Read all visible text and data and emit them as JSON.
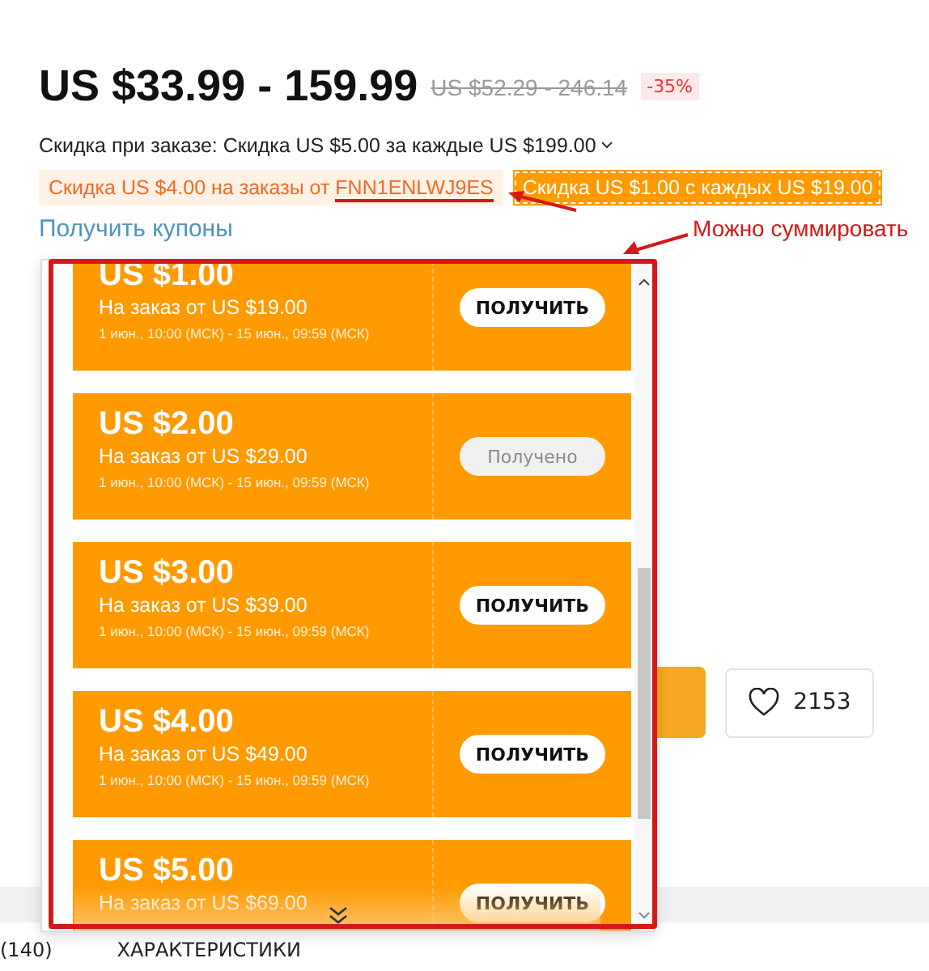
{
  "price": {
    "current": "US $33.99 - 159.99",
    "original": "US $52.29 - 246.14",
    "discount": "-35%"
  },
  "order_discount": {
    "label": "Скидка при заказе: Скидка US $5.00 за каждые US $199.00"
  },
  "promos": [
    {
      "kind": "code",
      "text": "Скидка US $4.00 на заказы от ",
      "code": "FNN1ENLWJ9ES"
    },
    {
      "kind": "store",
      "text": "Скидка US $1.00 с каждых US $19.00"
    }
  ],
  "get_coupons_link": "Получить купоны",
  "annotation": {
    "note": "Можно суммировать"
  },
  "coupons": [
    {
      "amount": "US $1.00",
      "min_order": "На заказ от US $19.00",
      "period": "1 июн., 10:00 (МСК) - 15 июн., 09:59 (МСК)",
      "button": "ПОЛУЧИТЬ",
      "received": false
    },
    {
      "amount": "US $2.00",
      "min_order": "На заказ от US $29.00",
      "period": "1 июн., 10:00 (МСК) - 15 июн., 09:59 (МСК)",
      "button": "Получено",
      "received": true
    },
    {
      "amount": "US $3.00",
      "min_order": "На заказ от US $39.00",
      "period": "1 июн., 10:00 (МСК) - 15 июн., 09:59 (МСК)",
      "button": "ПОЛУЧИТЬ",
      "received": false
    },
    {
      "amount": "US $4.00",
      "min_order": "На заказ от US $49.00",
      "period": "1 июн., 10:00 (МСК) - 15 июн., 09:59 (МСК)",
      "button": "ПОЛУЧИТЬ",
      "received": false
    },
    {
      "amount": "US $5.00",
      "min_order": "На заказ от US $69.00",
      "button": "ПОЛУЧИТЬ",
      "received": false
    }
  ],
  "wishlist": {
    "count": "2153"
  },
  "tabs": [
    {
      "label": "(140)"
    },
    {
      "label": "ХАРАКТЕРИСТИКИ"
    }
  ]
}
